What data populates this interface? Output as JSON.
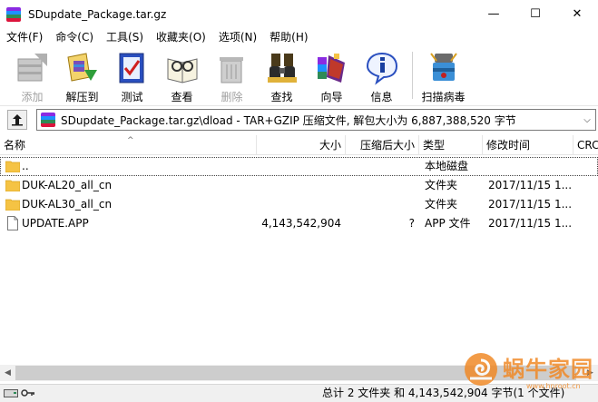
{
  "window": {
    "title": "SDupdate_Package.tar.gz",
    "minimize_glyph": "—",
    "maximize_glyph": "☐",
    "close_glyph": "✕"
  },
  "menu": [
    {
      "label": "文件(F)"
    },
    {
      "label": "命令(C)"
    },
    {
      "label": "工具(S)"
    },
    {
      "label": "收藏夹(O)"
    },
    {
      "label": "选项(N)"
    },
    {
      "label": "帮助(H)"
    }
  ],
  "toolbar": {
    "buttons": [
      {
        "label": "添加",
        "icon": "add-icon",
        "enabled": false
      },
      {
        "label": "解压到",
        "icon": "extract-to-icon",
        "enabled": true
      },
      {
        "label": "测试",
        "icon": "test-icon",
        "enabled": true
      },
      {
        "label": "查看",
        "icon": "view-icon",
        "enabled": true
      },
      {
        "label": "删除",
        "icon": "delete-icon",
        "enabled": false
      },
      {
        "label": "查找",
        "icon": "find-icon",
        "enabled": true
      },
      {
        "label": "向导",
        "icon": "wizard-icon",
        "enabled": true
      },
      {
        "label": "信息",
        "icon": "info-icon",
        "enabled": true
      },
      {
        "label": "扫描病毒",
        "icon": "virus-scan-icon",
        "enabled": true
      }
    ]
  },
  "address": {
    "path": "SDupdate_Package.tar.gz\\dload - TAR+GZIP 压缩文件, 解包大小为 6,887,388,520 字节",
    "up_icon": "up-folder-icon",
    "dropdown_glyph": "⌵"
  },
  "columns": {
    "name": "名称",
    "size": "大小",
    "packed": "压缩后大小",
    "type": "类型",
    "modified": "修改时间",
    "crc": "CRC"
  },
  "sort_indicator": "^",
  "files": [
    {
      "name": "..",
      "size": "",
      "packed": "",
      "type": "本地磁盘",
      "modified": "",
      "icon": "folder-icon"
    },
    {
      "name": "DUK-AL20_all_cn",
      "size": "",
      "packed": "",
      "type": "文件夹",
      "modified": "2017/11/15 1...",
      "icon": "folder-icon"
    },
    {
      "name": "DUK-AL30_all_cn",
      "size": "",
      "packed": "",
      "type": "文件夹",
      "modified": "2017/11/15 1...",
      "icon": "folder-icon"
    },
    {
      "name": "UPDATE.APP",
      "size": "4,143,542,904",
      "packed": "?",
      "type": "APP 文件",
      "modified": "2017/11/15 1...",
      "icon": "file-icon"
    }
  ],
  "scroll": {
    "left_glyph": "◀",
    "right_glyph": "▶"
  },
  "status": {
    "text": "总计 2 文件夹 和 4,143,542,904 字节(1 个文件)"
  },
  "watermark": {
    "text": "蜗牛家园",
    "url": "www.hnroot.cn"
  },
  "colors": {
    "accent_folder": "#f5c344",
    "watermark_orange": "#f08a28"
  }
}
